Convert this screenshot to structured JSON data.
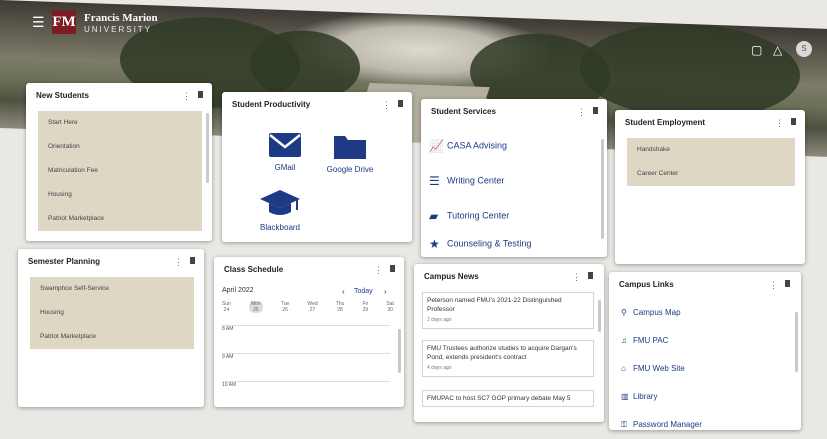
{
  "header": {
    "logo_mark": "FM",
    "logo_line1": "Francis Marion",
    "logo_line2": "UNIVERSITY",
    "user_initial": "S"
  },
  "new_students": {
    "title": "New Students",
    "items": [
      "Start Here",
      "Orientation",
      "Matriculation Fee",
      "Housing",
      "Patriot Marketplace"
    ]
  },
  "productivity": {
    "title": "Student Productivity",
    "apps": [
      {
        "label": "GMail",
        "icon": "mail-icon"
      },
      {
        "label": "Google Drive",
        "icon": "folder-icon"
      },
      {
        "label": "Blackboard",
        "icon": "graduation-cap-icon"
      }
    ]
  },
  "services": {
    "title": "Student Services",
    "items": [
      {
        "label": "CASA Advising",
        "icon": "chart-icon"
      },
      {
        "label": "Writing Center",
        "icon": "text-align-icon"
      },
      {
        "label": "Tutoring Center",
        "icon": "book-icon"
      },
      {
        "label": "Counseling & Testing",
        "icon": "star-icon"
      }
    ]
  },
  "employment": {
    "title": "Student Employment",
    "items": [
      "Handshake",
      "Career Center"
    ]
  },
  "semester": {
    "title": "Semester Planning",
    "items": [
      "Swamphox Self-Service",
      "Housing",
      "Patriot Marketplace"
    ]
  },
  "schedule": {
    "title": "Class Schedule",
    "month": "April 2022",
    "today": "Today",
    "days": [
      {
        "name": "Sun",
        "num": "24"
      },
      {
        "name": "Mon",
        "num": "25"
      },
      {
        "name": "Tue",
        "num": "26"
      },
      {
        "name": "Wed",
        "num": "27"
      },
      {
        "name": "Thu",
        "num": "28"
      },
      {
        "name": "Fri",
        "num": "29"
      },
      {
        "name": "Sat",
        "num": "30"
      }
    ],
    "times": [
      "8 AM",
      "9 AM",
      "10 AM"
    ]
  },
  "news": {
    "title": "Campus News",
    "items": [
      {
        "text": "Peterson named FMU's 2021-22 Distinguished Professor",
        "ago": "2 days ago"
      },
      {
        "text": "FMU Trustees authorize studies to acquire Dargan's Pond, extends president's contract",
        "ago": "4 days ago"
      },
      {
        "text": "FMUPAC to host SC7 GOP primary debate May 5",
        "ago": ""
      }
    ]
  },
  "links": {
    "title": "Campus Links",
    "items": [
      {
        "label": "Campus Map",
        "icon": "map-pin-icon"
      },
      {
        "label": "FMU PAC",
        "icon": "music-icon"
      },
      {
        "label": "FMU Web Site",
        "icon": "home-icon"
      },
      {
        "label": "Library",
        "icon": "library-icon"
      },
      {
        "label": "Password Manager",
        "icon": "key-icon"
      }
    ]
  },
  "colors": {
    "brand": "#7b1d23",
    "accent": "#1e3a84",
    "list_bg": "#ddd7c4"
  }
}
